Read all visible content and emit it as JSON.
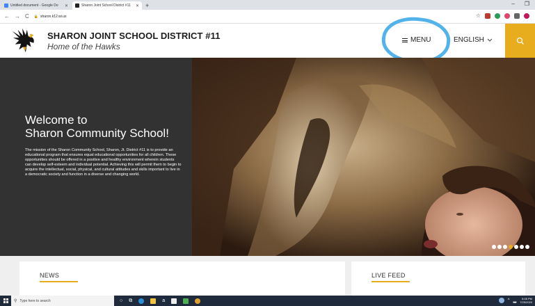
{
  "browser": {
    "tabs": [
      {
        "title": "Untitled document - Google Do",
        "color": "#4285f4",
        "active": false
      },
      {
        "title": "Sharon Joint School District #11",
        "color": "#222222",
        "active": true
      }
    ],
    "url": "sharon.k12.wi.us"
  },
  "header": {
    "school_name": "SHARON JOINT SCHOOL DISTRICT #11",
    "tagline": "Home of the Hawks",
    "menu_label": "MENU",
    "language_label": "ENGLISH",
    "accent_color": "#e8ad1e",
    "annotation_color": "#52b3eb"
  },
  "hero": {
    "title_line1": "Welcome to",
    "title_line2": "Sharon Community School!",
    "mission": "The mission of the Sharon Community School, Sharon, Jt. District #11 is to provide an educational program that ensures equal educational opportunities for all children. These opportunities should be offered in a positive and healthy environment wherein students can develop self-esteem and individual potential. Achieving this will permit them to begin to acquire the intellectual, social, physical, and cultural attitudes and skills important to live in a democratic society and function in a diverse and changing world.",
    "slides_total": 7,
    "slide_active": 4
  },
  "sections": {
    "news_title": "NEWS",
    "live_feed_title": "LIVE FEED"
  },
  "taskbar": {
    "search_placeholder": "Type here to search",
    "time": "6:08 PM",
    "date": "7/25/2020"
  }
}
